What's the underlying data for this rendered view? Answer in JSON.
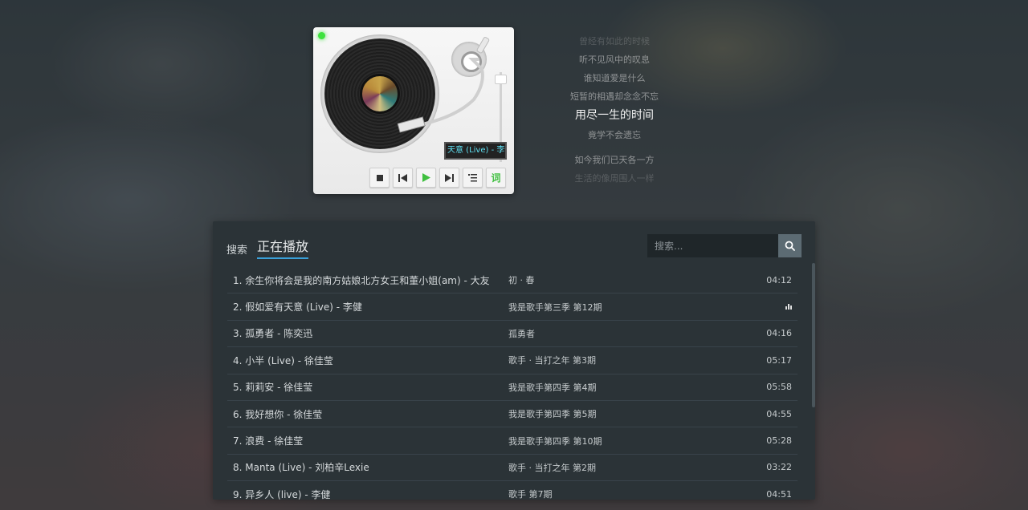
{
  "player": {
    "now_playing_display": "天意 (Live) - 李健",
    "controls": {
      "stop_label": "",
      "prev_label": "",
      "play_label": "",
      "next_label": "",
      "list_label": "",
      "lyrics_label": "词"
    }
  },
  "lyrics": [
    {
      "text": "曾经有如此的时候"
    },
    {
      "text": "听不见风中的叹息"
    },
    {
      "text": "谁知道爱是什么"
    },
    {
      "text": "短暂的相遇却念念不忘"
    },
    {
      "text": "用尽一生的时间"
    },
    {
      "text": "竟学不会遗忘"
    },
    {
      "text": "如今我们已天各一方"
    },
    {
      "text": "生活的像周围人一样"
    }
  ],
  "panel": {
    "tabs": [
      {
        "label": "搜索"
      },
      {
        "label": "正在播放"
      }
    ],
    "search": {
      "placeholder": "搜索...",
      "value": ""
    },
    "songs": [
      {
        "title": "1. 余生你将会是我的南方姑娘北方女王和董小姐(am) - 大友",
        "album": "初 · 春",
        "duration": "04:12",
        "playing": false
      },
      {
        "title": "2. 假如爱有天意 (Live) - 李健",
        "album": "我是歌手第三季 第12期",
        "duration": "",
        "playing": true
      },
      {
        "title": "3. 孤勇者 - 陈奕迅",
        "album": "孤勇者",
        "duration": "04:16",
        "playing": false
      },
      {
        "title": "4. 小半 (Live) - 徐佳莹",
        "album": "歌手 · 当打之年 第3期",
        "duration": "05:17",
        "playing": false
      },
      {
        "title": "5. 莉莉安 - 徐佳莹",
        "album": "我是歌手第四季 第4期",
        "duration": "05:58",
        "playing": false
      },
      {
        "title": "6. 我好想你 - 徐佳莹",
        "album": "我是歌手第四季 第5期",
        "duration": "04:55",
        "playing": false
      },
      {
        "title": "7. 浪费 - 徐佳莹",
        "album": "我是歌手第四季 第10期",
        "duration": "05:28",
        "playing": false
      },
      {
        "title": "8. Manta (Live) - 刘柏辛Lexie",
        "album": "歌手 · 当打之年 第2期",
        "duration": "03:22",
        "playing": false
      },
      {
        "title": "9. 异乡人 (live) - 李健",
        "album": "歌手 第7期",
        "duration": "04:51",
        "playing": false
      }
    ]
  },
  "colors": {
    "accent": "#3aa0d8",
    "led": "#3ee23e",
    "lcd_text": "#5fe0f2",
    "play_green": "#3fbf3f"
  },
  "icons": [
    "power-led-icon",
    "stop-icon",
    "prev-icon",
    "play-icon",
    "next-icon",
    "list-icon",
    "search-icon",
    "playing-bars-icon"
  ]
}
